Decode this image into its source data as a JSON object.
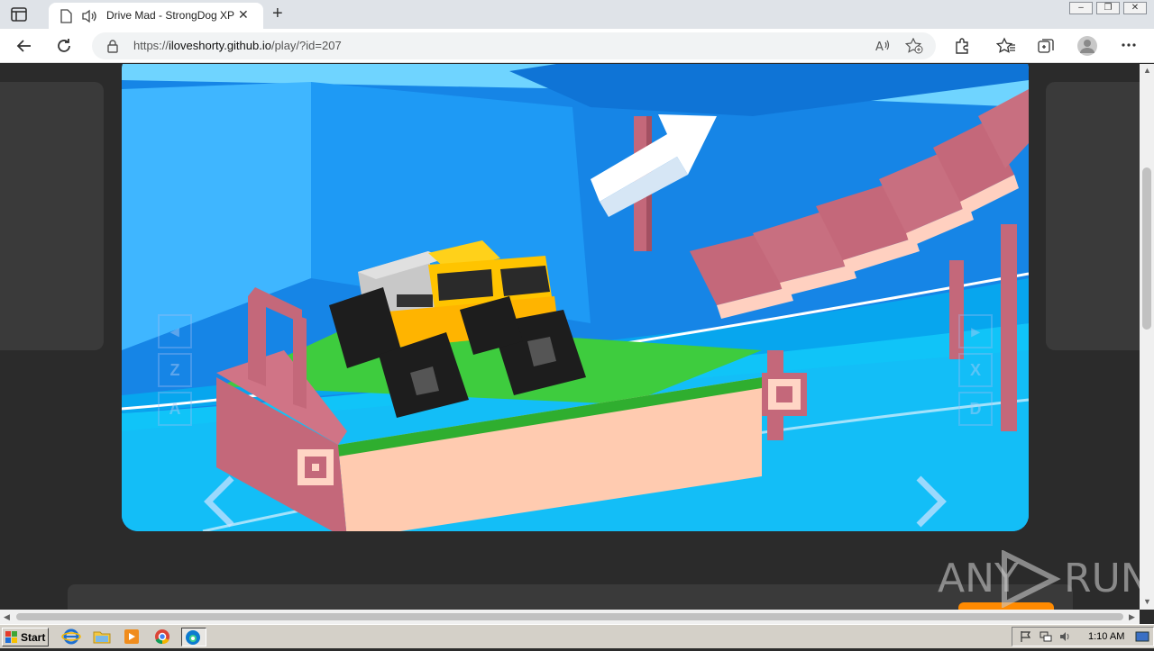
{
  "browser": {
    "tab": {
      "title": "Drive Mad - StrongDog XP"
    },
    "url": {
      "prefix": "https://",
      "host": "iloveshorty.github.io",
      "path": "/play/?id=207"
    },
    "window_buttons": [
      "–",
      "❐",
      "✕"
    ]
  },
  "game": {
    "left_keys": [
      "◂",
      "Z",
      "A"
    ],
    "right_keys": [
      "▸",
      "X",
      "D"
    ],
    "nav_prev": "‹",
    "nav_next": "›"
  },
  "watermark": {
    "left": "ANY",
    "right": "RUN"
  },
  "taskbar": {
    "start_label": "Start",
    "clock": "1:10 AM",
    "apps": [
      "internet-explorer",
      "file-explorer",
      "media-player",
      "chrome",
      "edge"
    ]
  },
  "colors": {
    "sky": "#1a8be8",
    "water": "#00b8f5",
    "grass": "#3ecc3e",
    "bridge": "#c46a78",
    "truck": "#ffc400"
  }
}
